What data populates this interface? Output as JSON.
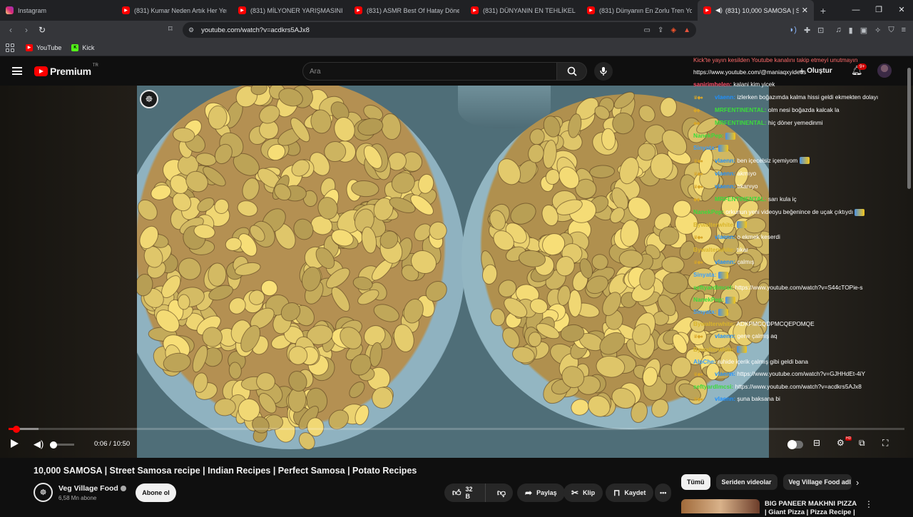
{
  "browser": {
    "tabs": [
      {
        "label": "Instagram",
        "icon": "instagram-icon",
        "active": false
      },
      {
        "label": "(831) Kumar Neden Artık Her Yerde?",
        "icon": "youtube-icon",
        "active": false
      },
      {
        "label": "(831) MİLYONER YARIŞMASINI DOLA",
        "icon": "youtube-icon",
        "active": false
      },
      {
        "label": "(831) ASMR Best Of Hatay Döner Ac",
        "icon": "youtube-icon",
        "active": false
      },
      {
        "label": "(831) DÜNYANIN EN TEHLİKELİ TREN",
        "icon": "youtube-icon",
        "active": false
      },
      {
        "label": "(831) Dünyanın En Zorlu Tren Yolculu",
        "icon": "youtube-icon",
        "active": false
      },
      {
        "label": "(831) 10,000 SAMOSA | Street",
        "icon": "youtube-icon",
        "active": true
      }
    ],
    "url": "youtube.com/watch?v=acdkrs5AJx8",
    "bookmarks": [
      {
        "label": "YouTube",
        "icon": "youtube-icon"
      },
      {
        "label": "Kick",
        "icon": "kick-icon"
      }
    ]
  },
  "masthead": {
    "logo_text": "Premium",
    "country_code": "TR",
    "search_placeholder": "Ara",
    "create_label": "Oluştur",
    "notification_count": "9+"
  },
  "chat": [
    {
      "user": "",
      "msg": "Kick'te yayın kesilden Youtube kanalını takip etmeyi unutmayın",
      "color": "#ff6b6b",
      "badges": ""
    },
    {
      "user": "",
      "msg": "https://www.youtube.com/@maniaqxyideos",
      "color": "#ffffff",
      "badges": ""
    },
    {
      "user": "sanirimhelen:",
      "msg": "kalani kim yicek",
      "color": "#ff4f6a",
      "badges": ""
    },
    {
      "user": "vlaenn:",
      "msg": "izlerken boğazımda kalma hissi geldi ekmekten dolayı",
      "color": "#1e90ff",
      "badges": "♛◆●"
    },
    {
      "user": "MRFENTINENTAL:",
      "msg": "olm nesi boğazda kalcak la",
      "color": "#3bdc3b",
      "badges": "◆◆"
    },
    {
      "user": "MRFENTINENTAL:",
      "msg": "hiç döner yemedinmi",
      "color": "#3bdc3b",
      "badges": "◆◆"
    },
    {
      "user": "NanekPep:",
      "msg": "",
      "color": "#3bdc3b",
      "badges": "",
      "emote": true
    },
    {
      "user": "Sinyata:",
      "msg": "",
      "color": "#3aa0ff",
      "badges": "",
      "emote": true
    },
    {
      "user": "vlaenn:",
      "msg": "ben içecelsiz içemiyom",
      "color": "#1e90ff",
      "badges": "♛◆●",
      "emote": true
    },
    {
      "user": "vlaenn:",
      "msg": "akmıyo",
      "color": "#1e90ff",
      "badges": "♛◆●"
    },
    {
      "user": "vlaenn:",
      "msg": "tıkanıyo",
      "color": "#1e90ff",
      "badges": "♛◆●"
    },
    {
      "user": "MRFENTINENTAL:",
      "msg": "sarı kula iç",
      "color": "#3bdc3b",
      "badges": "◆◆"
    },
    {
      "user": "NanekPep:",
      "msg": "orkunun yeni videoyu beğenince de uçak çıktıydı",
      "color": "#3bdc3b",
      "badges": "",
      "emote": true
    },
    {
      "user": "Bywalterwhite:",
      "msg": "",
      "color": "#d9b52c",
      "badges": "",
      "emote": true
    },
    {
      "user": "vlaenn:",
      "msg": "o ekmek keserdi",
      "color": "#1e90ff",
      "badges": "♛◆●"
    },
    {
      "user": "Bywalterwhite:",
      "msg": "tıkar",
      "color": "#d9b52c",
      "badges": ""
    },
    {
      "user": "vlaenn:",
      "msg": "çalmış",
      "color": "#1e90ff",
      "badges": "♛◆●"
    },
    {
      "user": "Sinyata:",
      "msg": "",
      "color": "#3aa0ff",
      "badges": "",
      "emote": true
    },
    {
      "user": "seftyardlmcsi:",
      "msg": "https://www.youtube.com/watch?v=S44cTOPie-s",
      "color": "#3bdc3b",
      "badges": ""
    },
    {
      "user": "NanekPep:",
      "msg": "",
      "color": "#3bdc3b",
      "badges": "",
      "emote": true
    },
    {
      "user": "Sinyata:",
      "msg": "",
      "color": "#3aa0ff",
      "badges": "",
      "emote": true
    },
    {
      "user": "Bywalterwhite:",
      "msg": "ADKPMCQDPMCQEPOMQE",
      "color": "#d9b52c",
      "badges": ""
    },
    {
      "user": "vlaenn:",
      "msg": "gene çalmış aq",
      "color": "#1e90ff",
      "badges": "♛◆●"
    },
    {
      "user": "Bywalterwhite:",
      "msg": "",
      "color": "#d9b52c",
      "badges": "",
      "emote": true
    },
    {
      "user": "AlpChe:",
      "msg": "ruhide içerik çalmış gibi geldi bana",
      "color": "#3aa0ff",
      "badges": ""
    },
    {
      "user": "vlaenn:",
      "msg": "https://www.youtube.com/watch?v=GJHHdEt-4iY",
      "color": "#1e90ff",
      "badges": "♛◆●"
    },
    {
      "user": "seftyardlmcsi:",
      "msg": "https://www.youtube.com/watch?v=acdkrs5AJx8",
      "color": "#3bdc3b",
      "badges": ""
    },
    {
      "user": "vlaenn:",
      "msg": "şuna baksana bi",
      "color": "#1e90ff",
      "badges": "♛◆●"
    }
  ],
  "player": {
    "time": "0:06 / 10:50",
    "progress_fraction": 0.009,
    "volume_fraction": 0.15
  },
  "video": {
    "title": "10,000 SAMOSA | Street Samosa recipe | Indian Recipes | Perfect Samosa | Potato Recipes",
    "channel": "Veg Village Food",
    "subscribers": "6,58 Mn abone",
    "subscribe_label": "Abone ol",
    "likes": "32 B",
    "share_label": "Paylaş",
    "clip_label": "Klip",
    "save_label": "Kaydet"
  },
  "sidebar": {
    "chips": [
      "Tümü",
      "Seriden videolar",
      "Veg Village Food adl"
    ],
    "recommended_title": "BIG PANEER MAKHNI PIZZA | Giant Pizza | Pizza Recipe |"
  }
}
